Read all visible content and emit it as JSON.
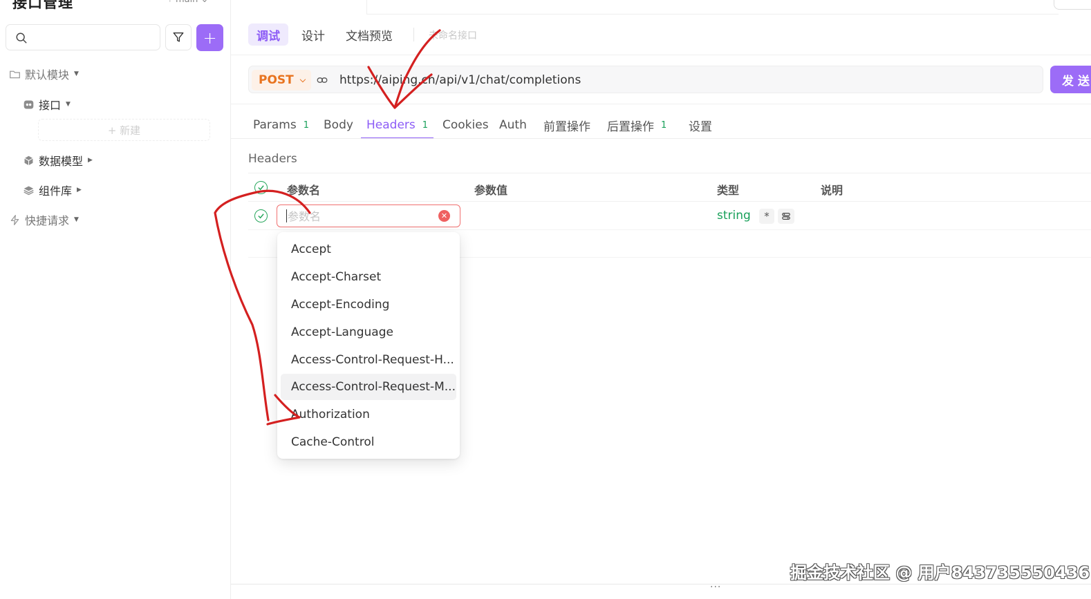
{
  "sidebar": {
    "title": "接口管理",
    "branch": "main",
    "search": {
      "value": "",
      "placeholder": ""
    },
    "add_label": "+",
    "items": [
      {
        "label": "默认模块"
      },
      {
        "label": "接口"
      },
      {
        "label": "+ 新建"
      },
      {
        "label": "数据模型"
      },
      {
        "label": "组件库"
      },
      {
        "label": "快捷请求"
      }
    ]
  },
  "mode_tabs": [
    {
      "label": "调试",
      "active": true
    },
    {
      "label": "设计"
    },
    {
      "label": "文档预览"
    }
  ],
  "api_name": "未命名接口",
  "request": {
    "method": "POST",
    "url": "https://aiping.cn/api/v1/chat/completions",
    "send_label": "发送"
  },
  "request_tabs": [
    {
      "label": "Params",
      "count": "1"
    },
    {
      "label": "Body"
    },
    {
      "label": "Headers",
      "count": "1",
      "active": true
    },
    {
      "label": "Cookies"
    },
    {
      "label": "Auth"
    },
    {
      "label": "前置操作"
    },
    {
      "label": "后置操作",
      "count": "1"
    },
    {
      "label": "设置"
    }
  ],
  "headers": {
    "section_title": "Headers",
    "columns": {
      "name": "参数名",
      "value": "参数值",
      "type": "类型",
      "desc": "说明"
    },
    "row": {
      "name_value": "",
      "name_placeholder": "参数名",
      "type": "string",
      "required_symbol": "*"
    },
    "suggestions": [
      "Accept",
      "Accept-Charset",
      "Accept-Encoding",
      "Accept-Language",
      "Access-Control-Request-H...",
      "Access-Control-Request-M...",
      "Authorization",
      "Cache-Control"
    ],
    "highlighted_suggestion": "Access-Control-Request-M..."
  },
  "footer": {
    "resize_handle": "...",
    "watermark": "掘金技术社区 @ 用户843735550436"
  },
  "colors": {
    "accent": "#9c6cf7",
    "method": "#e8731e",
    "success": "#19a05a",
    "error": "#ef6161",
    "annotation": "#d42020"
  }
}
